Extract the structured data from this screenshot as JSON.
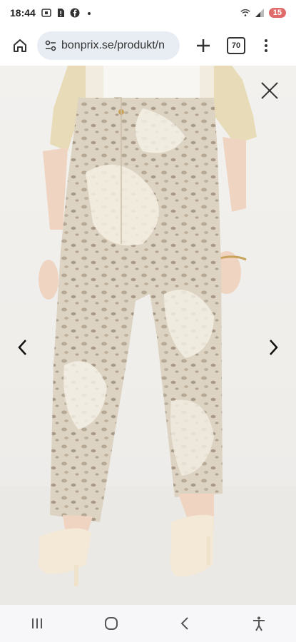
{
  "status_bar": {
    "time": "18:44",
    "battery_level": "15",
    "icons": [
      "screenshot-icon",
      "sim-alert-icon",
      "facebook-icon",
      "dot-icon",
      "wifi-icon",
      "signal-icon"
    ]
  },
  "browser": {
    "url": "bonprix.se/produkt/n",
    "tab_count": "70"
  },
  "viewer": {
    "image_subject": "beige animal print cropped jeans",
    "controls": [
      "close-icon",
      "chevron-left-icon",
      "chevron-right-icon"
    ]
  },
  "system_nav": [
    "recent-apps-icon",
    "home-icon",
    "back-icon",
    "accessibility-icon"
  ]
}
